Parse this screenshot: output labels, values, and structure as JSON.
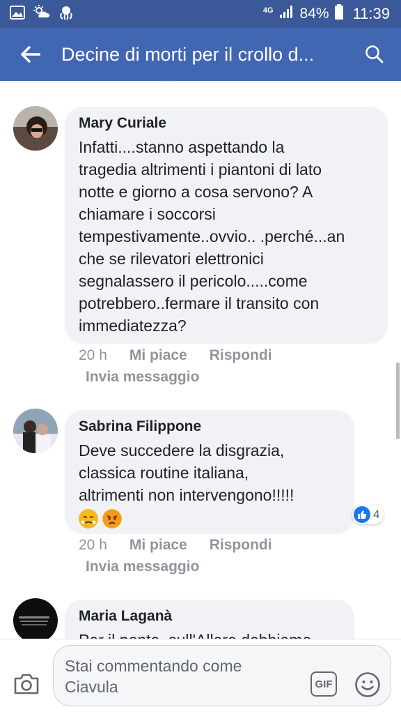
{
  "status_bar": {
    "network": "4G",
    "battery": "84%",
    "time": "11:39"
  },
  "app_bar": {
    "title": "Decine di morti per il crollo d..."
  },
  "comments": [
    {
      "author": "Mary Curiale",
      "text": "Infatti....stanno aspettando la\ntragedia altrimenti i piantoni di lato\nnotte e giorno a cosa servono? A\nchiamare i soccorsi\ntempestivamente..ovvio.. .perché...an\nche se rilevatori elettronici\nsegnalassero il pericolo.....come\npotrebbero..fermare il transito con\nimmediatezza?",
      "time": "20 h",
      "like": "Mi piace",
      "reply": "Rispondi",
      "message": "Invia messaggio"
    },
    {
      "author": "Sabrina Filippone",
      "text": "Deve succedere la disgrazia,\nclassica routine italiana,\naltrimenti non intervengono!!!!!",
      "reactions_count": "4",
      "time": "20 h",
      "like": "Mi piace",
      "reply": "Rispondi",
      "message": "Invia messaggio"
    },
    {
      "author": "Maria Laganà",
      "text": "Per il ponte, sull'Allaro dobbiamo"
    }
  ],
  "composer": {
    "placeholder": "Stai commentando come\nCiavula",
    "gif_label": "GIF"
  }
}
